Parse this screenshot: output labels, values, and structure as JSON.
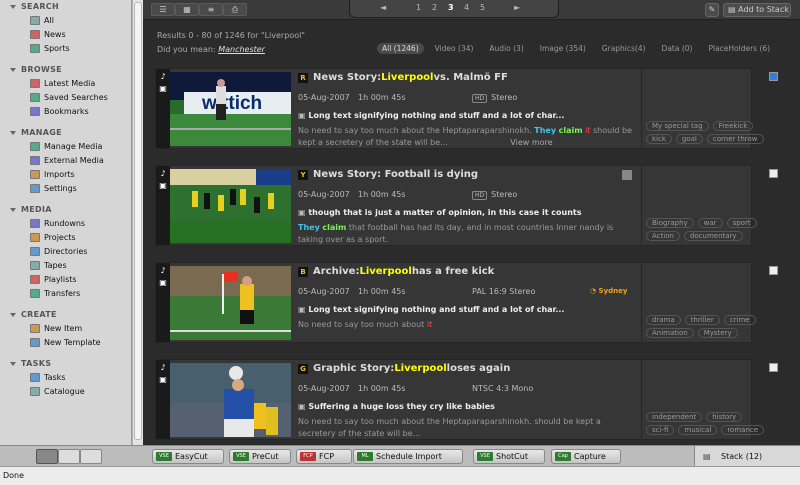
{
  "sidebar": {
    "sections": [
      {
        "title": "SEARCH",
        "items": [
          "All",
          "News",
          "Sports"
        ]
      },
      {
        "title": "BROWSE",
        "items": [
          "Latest Media",
          "Saved Searches",
          "Bookmarks"
        ]
      },
      {
        "title": "MANAGE",
        "items": [
          "Manage Media",
          "External Media",
          "Imports",
          "Settings"
        ]
      },
      {
        "title": "MEDIA",
        "items": [
          "Rundowns",
          "Projects",
          "Directories",
          "Tapes",
          "Playlists",
          "Transfers"
        ]
      },
      {
        "title": "CREATE",
        "items": [
          "New Item",
          "New Template"
        ]
      },
      {
        "title": "TASKS",
        "items": [
          "Tasks",
          "Catalogue"
        ]
      }
    ]
  },
  "toolbar": {
    "add_to_stack": "Add to Stack",
    "pages": [
      "1",
      "2",
      "3",
      "4",
      "5"
    ],
    "current_page": "3",
    "prev": "◄",
    "next": "►"
  },
  "results": {
    "summary": "Results 0 - 80 of 1246 for \"Liverpool\"",
    "did_you_mean": "Did you mean:",
    "suggestion": "Manchester"
  },
  "filters": [
    {
      "label": "All (1246)",
      "active": true
    },
    {
      "label": "Video (34)",
      "active": false
    },
    {
      "label": "Audio (3)",
      "active": false
    },
    {
      "label": "Image (354)",
      "active": false
    },
    {
      "label": "Graphics(4)",
      "active": false
    },
    {
      "label": "Data (0)",
      "active": false
    },
    {
      "label": "PlaceHolders (6)",
      "active": false
    }
  ],
  "cards": [
    {
      "badge": "R",
      "title_pre": "News Story: ",
      "title_hl": "Liverpool",
      "title_post": " vs. Malmö FF",
      "date": "05-Aug-2007",
      "duration": "1h 00m 45s",
      "format": "Stereo",
      "format_badge": "HD",
      "bold_line": "Long text signifying nothing and stuff and a lot of char...",
      "desc_pre": "No need to say too much about the Heptaparaparshinokh. ",
      "desc_w1": "They",
      "desc_w2": "claim",
      "desc_w3": "it",
      "desc_post": " should be kept a secretery of the state will be...",
      "view_more": "View more",
      "tags": [
        "My special tag",
        "Freekick",
        "kick",
        "goal",
        "corner throw"
      ],
      "checked": true
    },
    {
      "badge": "Y",
      "title_pre": "News Story: Football is dying",
      "title_hl": "",
      "title_post": "",
      "date": "05-Aug-2007",
      "duration": "1h 00m 45s",
      "format": "Stereo",
      "format_badge": "HD",
      "bold_line": "though that is just a matter of opinion, in this case it counts",
      "desc_pre": "",
      "desc_w1": "They",
      "desc_w2": "claim",
      "desc_w3": "",
      "desc_post": " that football has had its day, and in most countries Inner nandy is taking over as a sport.",
      "view_more": "",
      "tags": [
        "Biography",
        "war",
        "sport",
        "Action",
        "documentary"
      ],
      "checked": false
    },
    {
      "badge": "B",
      "title_pre": "Archive: ",
      "title_hl": "Liverpool",
      "title_post": " has a free kick",
      "date": "05-Aug-2007",
      "duration": "1h 00m 45s",
      "format": "PAL 16:9 Stereo",
      "format_badge": "",
      "location": "Sydney",
      "bold_line": "Long text signifying nothing and stuff and a lot of char...",
      "desc_pre": "No need to say too much about ",
      "desc_w1": "",
      "desc_w2": "",
      "desc_w3": "it",
      "desc_post": "",
      "view_more": "",
      "tags": [
        "drama",
        "thriller",
        "crime",
        "Animation",
        "Mystery"
      ],
      "checked": false
    },
    {
      "badge": "G",
      "title_pre": "Graphic Story: ",
      "title_hl": "Liverpool",
      "title_post": " loses again",
      "date": "05-Aug-2007",
      "duration": "1h 00m 45s",
      "format": "NTSC 4:3 Mono",
      "format_badge": "",
      "bold_line": "Suffering a huge loss they cry like babies",
      "desc_pre": "No need to say too much about the Heptaparaparshinokh. should be kept a secretery of the state will be...",
      "desc_w1": "",
      "desc_w2": "",
      "desc_w3": "",
      "desc_post": "",
      "view_more": "",
      "tags": [
        "independent",
        "history",
        "sci-fi",
        "musical",
        "romance"
      ],
      "checked": false
    }
  ],
  "bottom": {
    "buttons": [
      {
        "label": "EasyCut",
        "icon": "VSE"
      },
      {
        "label": "PreCut",
        "icon": "VSE"
      },
      {
        "label": "FCP",
        "icon": "FCP"
      },
      {
        "label": "Schedule Import",
        "icon": "ML"
      },
      {
        "label": "ShotCut",
        "icon": "VSE"
      },
      {
        "label": "Capture",
        "icon": "Cap"
      }
    ],
    "stack": "Stack (12)"
  },
  "status": "Done"
}
